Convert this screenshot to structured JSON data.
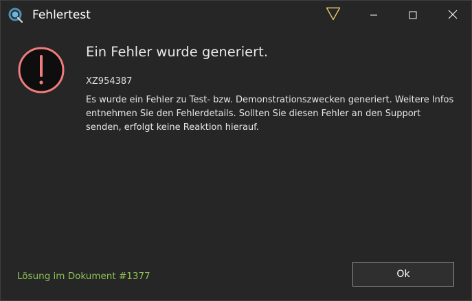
{
  "window": {
    "title": "Fehlertest",
    "icons": {
      "app": "app-logo-icon",
      "warning": "warning-triangle-icon",
      "minimize": "minimize-icon",
      "maximize": "maximize-icon",
      "close": "close-icon"
    },
    "colors": {
      "background": "#262626",
      "warning_accent": "#e8c86a"
    }
  },
  "error": {
    "icon": "error-exclamation-icon",
    "icon_color": "#f07c7c",
    "heading": "Ein Fehler wurde generiert.",
    "code": "XZ954387",
    "message": "Es wurde ein Fehler zu Test- bzw. Demonstrationszwecken generiert. Weitere Infos entnehmen Sie den Fehlerdetails. Sollten Sie diesen Fehler an den Support senden, erfolgt keine Reaktion hierauf."
  },
  "footer": {
    "solution_link": "Lösung im Dokument #1377",
    "link_color": "#8cc152",
    "ok_label": "Ok"
  }
}
